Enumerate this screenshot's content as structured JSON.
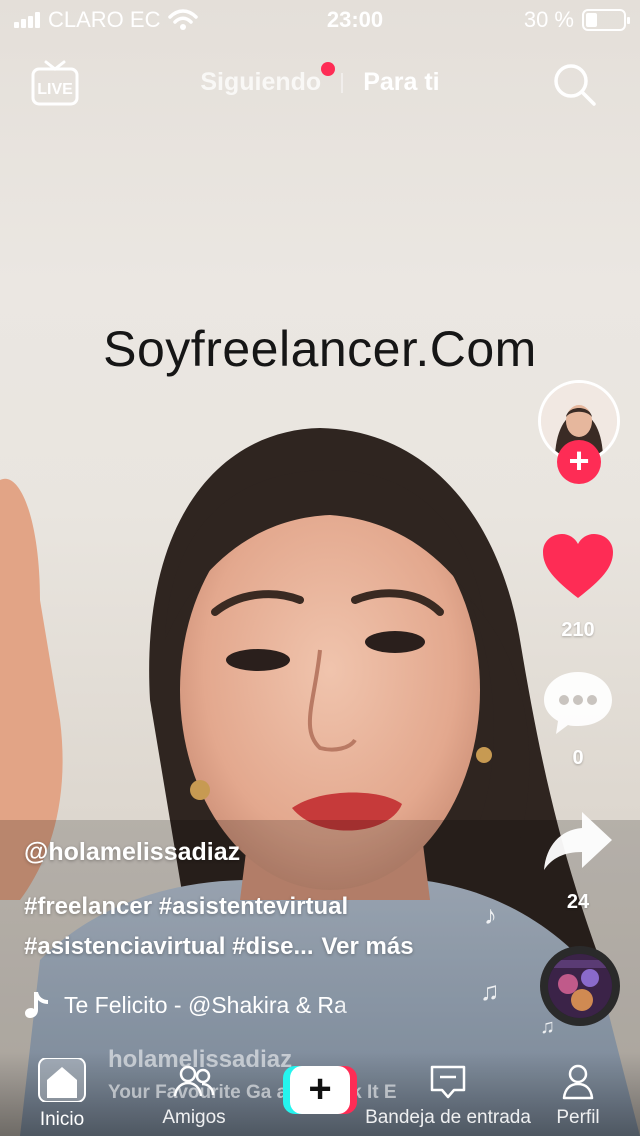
{
  "status_bar": {
    "carrier": "CLARO EC",
    "time": "23:00",
    "battery_text": "30 %",
    "battery_level": 0.3
  },
  "top_nav": {
    "live_label": "LIVE",
    "tabs": [
      {
        "label": "Siguiendo",
        "has_notification_dot": true
      },
      {
        "label": "Para ti",
        "active": true
      }
    ]
  },
  "video": {
    "overlay_text": "Soyfreelancer.Com"
  },
  "right_rail": {
    "likes": "210",
    "comments": "0",
    "shares": "24"
  },
  "caption": {
    "username": "@holamelissadiaz",
    "hashtags_line1": "#freelancer #asistentevirtual",
    "hashtags_line2": "#asistenciavirtual #dise...",
    "see_more": "Ver más",
    "music": "Te Felicito - @Shakira & Ra"
  },
  "background_ghost": {
    "line1": "holamelissadiaz",
    "line2": "Your Favourite Ga      aby Work It  E"
  },
  "bottom_nav": {
    "items": [
      {
        "label": "Inicio",
        "icon": "home-icon",
        "active": true
      },
      {
        "label": "Amigos",
        "icon": "friends-icon"
      },
      {
        "label": "",
        "icon": "create-plus-icon"
      },
      {
        "label": "Bandeja de entrada",
        "icon": "inbox-icon"
      },
      {
        "label": "Perfil",
        "icon": "profile-icon"
      }
    ]
  },
  "colors": {
    "accent": "#fe2c55",
    "cyan": "#25f4ee",
    "white": "#ffffff"
  }
}
